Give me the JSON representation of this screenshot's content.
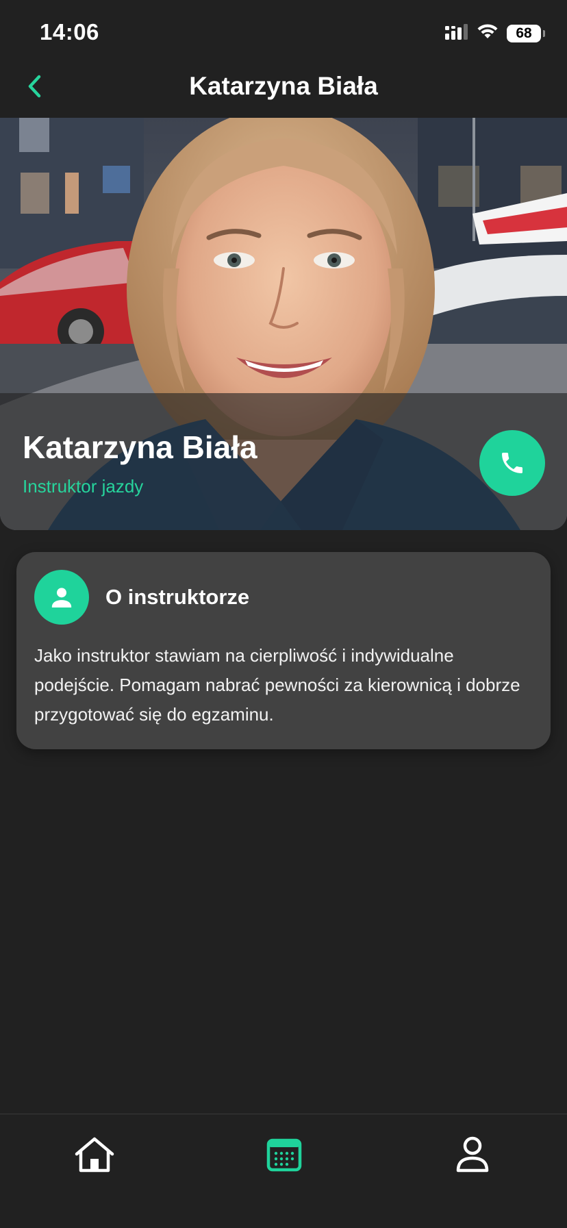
{
  "status_bar": {
    "time": "14:06",
    "battery": "68"
  },
  "header": {
    "title": "Katarzyna Biała",
    "back_icon": "chevron-left-icon"
  },
  "profile": {
    "name": "Katarzyna Biała",
    "role": "Instruktor jazdy",
    "call_icon": "phone-icon"
  },
  "about": {
    "title": "O instruktorze",
    "icon": "person-icon",
    "text": "Jako instruktor stawiam na cierpliwość i indywidualne podejście. Pomagam nabrać pewności za kierownicą i dobrze przygotować się do egzaminu."
  },
  "tab_bar": {
    "items": [
      {
        "icon": "home-icon",
        "active": false
      },
      {
        "icon": "calendar-icon",
        "active": true
      },
      {
        "icon": "profile-icon",
        "active": false
      }
    ]
  },
  "colors": {
    "accent": "#1fd39b",
    "accent_text": "#27d49c",
    "background": "#212121",
    "card": "#424242"
  }
}
